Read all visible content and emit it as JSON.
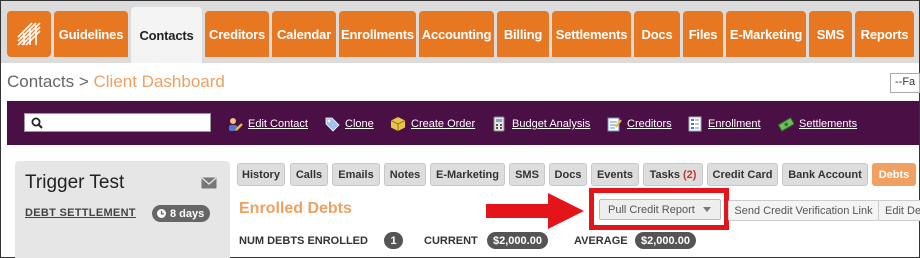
{
  "nav": {
    "tabs": [
      {
        "label": "Guidelines"
      },
      {
        "label": "Contacts"
      },
      {
        "label": "Creditors"
      },
      {
        "label": "Calendar"
      },
      {
        "label": "Enrollments"
      },
      {
        "label": "Accounting"
      },
      {
        "label": "Billing"
      },
      {
        "label": "Settlements"
      },
      {
        "label": "Docs"
      },
      {
        "label": "Files"
      },
      {
        "label": "E-Marketing"
      },
      {
        "label": "SMS"
      },
      {
        "label": "Reports"
      }
    ],
    "active": "Contacts"
  },
  "breadcrumb": {
    "root": "Contacts",
    "separator": ">",
    "current": "Client Dashboard"
  },
  "topright": {
    "value": "--Fa"
  },
  "toolbar": {
    "search_placeholder": "",
    "links": [
      {
        "label": "Edit Contact",
        "icon": "user-edit-icon"
      },
      {
        "label": "Clone",
        "icon": "tag-icon"
      },
      {
        "label": "Create Order",
        "icon": "box-icon"
      },
      {
        "label": "Budget Analysis",
        "icon": "calculator-icon"
      },
      {
        "label": "Creditors",
        "icon": "notepad-icon"
      },
      {
        "label": "Enrollment",
        "icon": "form-icon"
      },
      {
        "label": "Settlements",
        "icon": "money-icon"
      }
    ]
  },
  "client": {
    "name": "Trigger Test",
    "program": "DEBT SETTLEMENT",
    "days": "8 days"
  },
  "content_tabs": [
    {
      "label": "History"
    },
    {
      "label": "Calls"
    },
    {
      "label": "Emails"
    },
    {
      "label": "Notes"
    },
    {
      "label": "E-Marketing"
    },
    {
      "label": "SMS"
    },
    {
      "label": "Docs"
    },
    {
      "label": "Events"
    },
    {
      "label": "Tasks",
      "count": "(2)"
    },
    {
      "label": "Credit Card"
    },
    {
      "label": "Bank Account"
    },
    {
      "label": "Debts"
    }
  ],
  "content": {
    "title": "Enrolled Debts",
    "pull_credit_label": "Pull Credit Report",
    "verify_label": "Send Credit Verification Link",
    "edit_label": "Edit De",
    "stats": {
      "num_label": "NUM DEBTS ENROLLED",
      "num_value": "1",
      "current_label": "CURRENT",
      "current_value": "$2,000.00",
      "average_label": "AVERAGE",
      "average_value": "$2,000.00"
    }
  },
  "colors": {
    "brand_orange": "#e87722",
    "toolbar_purple": "#4a0f45",
    "highlight_red": "#e4141b"
  }
}
